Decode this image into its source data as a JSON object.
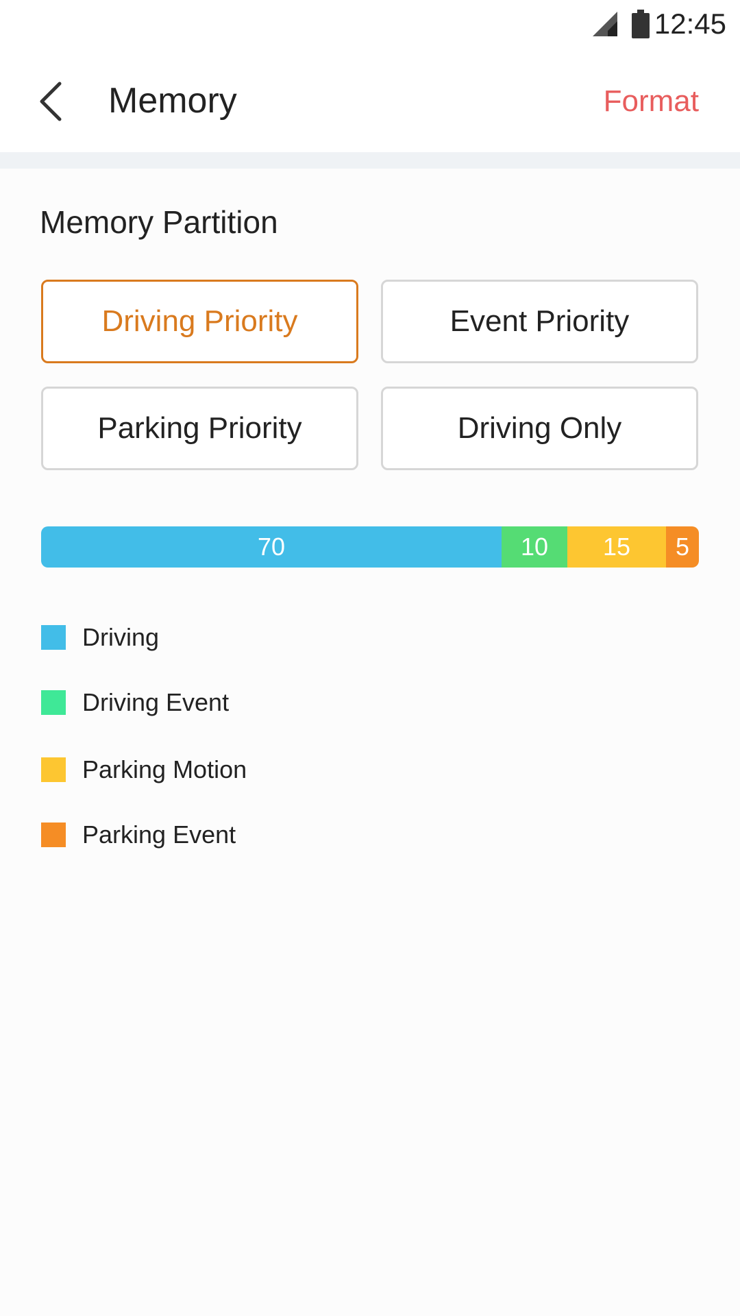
{
  "status_bar": {
    "time": "12:45",
    "icons": [
      "signal-icon",
      "battery-icon"
    ]
  },
  "app_bar": {
    "back_icon": "chevron-left-icon",
    "title": "Memory",
    "action_label": "Format",
    "action_color": "#e85d5d"
  },
  "section": {
    "title": "Memory Partition"
  },
  "options": [
    {
      "label": "Driving Priority",
      "selected": true
    },
    {
      "label": "Event Priority",
      "selected": false
    },
    {
      "label": "Parking Priority",
      "selected": false
    },
    {
      "label": "Driving Only",
      "selected": false
    }
  ],
  "accent_color": "#d97a1e",
  "partition": [
    {
      "name": "Driving",
      "value": 70,
      "label": "70",
      "color": "#42bde8"
    },
    {
      "name": "Driving Event",
      "value": 10,
      "label": "10",
      "color": "#55dc74"
    },
    {
      "name": "Parking Motion",
      "value": 15,
      "label": "15",
      "color": "#fdc631"
    },
    {
      "name": "Parking Event",
      "value": 5,
      "label": "5",
      "color": "#f58d25"
    }
  ],
  "legend": [
    {
      "label": "Driving",
      "color": "#42bde8"
    },
    {
      "label": "Driving Event",
      "color": "#3fe897"
    },
    {
      "label": "Parking Motion",
      "color": "#fdc631"
    },
    {
      "label": "Parking Event",
      "color": "#f58d25"
    }
  ]
}
